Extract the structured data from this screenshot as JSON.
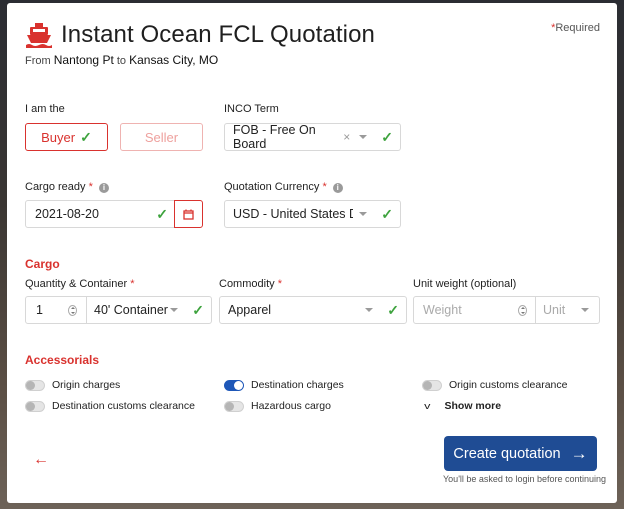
{
  "header": {
    "title": "Instant Ocean FCL Quotation",
    "from_word": "From",
    "origin": "Nantong Pt",
    "to_word": "to",
    "destination": "Kansas City, MO",
    "required_marker": "*",
    "required_label": "Required"
  },
  "role": {
    "label": "I am the",
    "buyer_label": "Buyer",
    "seller_label": "Seller",
    "selected": "Buyer"
  },
  "inco": {
    "label": "INCO Term",
    "value": "FOB - Free On Board",
    "clear_glyph": "×"
  },
  "cargo_ready": {
    "label": "Cargo ready",
    "required_marker": "*",
    "value": "2021-08-20"
  },
  "currency": {
    "label": "Quotation Currency",
    "required_marker": "*",
    "value": "USD - United States Do..."
  },
  "cargo": {
    "section_title": "Cargo",
    "quantity_label": "Quantity & Container",
    "quantity_required": "*",
    "quantity_value": "1",
    "container_value": "40' Container",
    "commodity_label": "Commodity",
    "commodity_required": "*",
    "commodity_value": "Apparel",
    "weight_label": "Unit weight (optional)",
    "weight_placeholder": "Weight",
    "unit_placeholder": "Unit"
  },
  "accessorials": {
    "section_title": "Accessorials",
    "items": [
      {
        "label": "Origin charges",
        "on": false
      },
      {
        "label": "Destination charges",
        "on": true
      },
      {
        "label": "Origin customs clearance",
        "on": false
      },
      {
        "label": "Destination customs clearance",
        "on": false
      },
      {
        "label": "Hazardous cargo",
        "on": false
      }
    ],
    "show_more_label": "Show more"
  },
  "footer": {
    "back_glyph": "←",
    "create_label": "Create quotation",
    "create_arrow": "→",
    "login_note": "You'll be asked to login before continuing"
  },
  "colors": {
    "accent_red": "#d9322e",
    "primary_blue": "#1f4c94",
    "valid_green": "#3ea33e"
  }
}
